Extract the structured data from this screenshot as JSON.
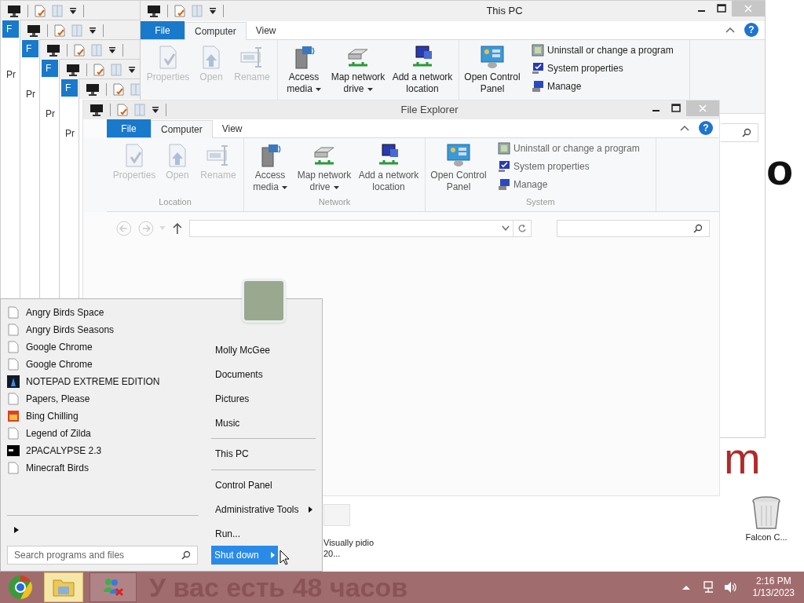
{
  "ghost_windows": [
    {
      "file_tab": "F",
      "label": "Pr"
    },
    {
      "file_tab": "F",
      "label": "Pr"
    },
    {
      "file_tab": "F",
      "label": "Pr"
    },
    {
      "file_tab": "F",
      "label": "Pr"
    }
  ],
  "main_window": {
    "title": "This PC",
    "help": "?",
    "tabs": [
      {
        "label": "File",
        "kind": "file",
        "selected": false
      },
      {
        "label": "Computer",
        "kind": "tab",
        "selected": true
      },
      {
        "label": "View",
        "kind": "tab",
        "selected": false
      }
    ],
    "groups": [
      {
        "items": [
          {
            "label": "Properties",
            "disabled": true,
            "dropdown": false
          },
          {
            "label": "Open",
            "disabled": true,
            "dropdown": false
          },
          {
            "label": "Rename",
            "disabled": true,
            "dropdown": false
          }
        ]
      },
      {
        "items": [
          {
            "label": "Access media",
            "disabled": false,
            "dropdown": true
          },
          {
            "label": "Map network drive",
            "disabled": false,
            "dropdown": true
          },
          {
            "label": "Add a network location",
            "disabled": false,
            "dropdown": false
          }
        ]
      },
      {
        "items": [
          {
            "label": "Open Control Panel",
            "disabled": false,
            "dropdown": false
          }
        ],
        "small_items": [
          "Uninstall or change a program",
          "System properties",
          "Manage"
        ]
      }
    ]
  },
  "file_explorer": {
    "title": "File Explorer",
    "help": "?",
    "tabs": [
      {
        "label": "File",
        "kind": "file",
        "selected": false
      },
      {
        "label": "Computer",
        "kind": "tab",
        "selected": true
      },
      {
        "label": "View",
        "kind": "tab",
        "selected": false
      }
    ],
    "groups": [
      {
        "label": "Location",
        "items": [
          {
            "label": "Properties",
            "disabled": true,
            "dropdown": false
          },
          {
            "label": "Open",
            "disabled": true,
            "dropdown": false
          },
          {
            "label": "Rename",
            "disabled": true,
            "dropdown": false
          }
        ]
      },
      {
        "label": "Network",
        "items": [
          {
            "label": "Access media",
            "disabled": false,
            "dropdown": true
          },
          {
            "label": "Map network drive",
            "disabled": false,
            "dropdown": true
          },
          {
            "label": "Add a network location",
            "disabled": false,
            "dropdown": false
          }
        ]
      },
      {
        "label": "System",
        "items": [
          {
            "label": "Open Control Panel",
            "disabled": false,
            "dropdown": false
          }
        ],
        "small_items": [
          "Uninstall or change a program",
          "System properties",
          "Manage"
        ]
      }
    ]
  },
  "wallpaper": {
    "banner": "У вас есть 48 часов",
    "letters": [
      {
        "text": "o",
        "kind": "dark"
      },
      {
        "text": "m",
        "kind": "red"
      }
    ]
  },
  "desktop_icons": [
    {
      "label": "Visually pidio 20...",
      "kind": "app"
    },
    {
      "label": "Falcon C...",
      "kind": "bin"
    }
  ],
  "start_menu": {
    "programs": [
      {
        "label": "Angry Birds Space",
        "kind": "file"
      },
      {
        "label": "Angry Birds Seasons",
        "kind": "file"
      },
      {
        "label": "Google Chrome",
        "kind": "file"
      },
      {
        "label": "Google Chrome",
        "kind": "file"
      },
      {
        "label": "NOTEPAD EXTREME EDITION",
        "kind": "notepad"
      },
      {
        "label": "Papers, Please",
        "kind": "file"
      },
      {
        "label": "Bing Chilling",
        "kind": "game"
      },
      {
        "label": "Legend of Zilda",
        "kind": "file"
      },
      {
        "label": "2PACALYPSE 2.3",
        "kind": "console"
      },
      {
        "label": "Minecraft Birds",
        "kind": "file"
      }
    ],
    "places": [
      {
        "label": "Molly McGee",
        "separator_before": false,
        "submenu": false
      },
      {
        "label": "Documents",
        "separator_before": false,
        "submenu": false
      },
      {
        "label": "Pictures",
        "separator_before": false,
        "submenu": false
      },
      {
        "label": "Music",
        "separator_before": false,
        "submenu": false
      },
      {
        "label": "This PC",
        "separator_before": true,
        "submenu": false
      },
      {
        "label": "Control Panel",
        "separator_before": true,
        "submenu": false
      },
      {
        "label": "Administrative Tools",
        "separator_before": false,
        "submenu": true
      },
      {
        "label": "Run...",
        "separator_before": false,
        "submenu": false
      }
    ],
    "search": {
      "placeholder": "Search programs and files"
    },
    "shutdown": {
      "label": "Shut down"
    }
  },
  "taskbar": {
    "apps": [
      {
        "active": false
      },
      {
        "active": true
      },
      {
        "active": false
      }
    ],
    "time": "2:16 PM",
    "date": "1/13/2023"
  }
}
